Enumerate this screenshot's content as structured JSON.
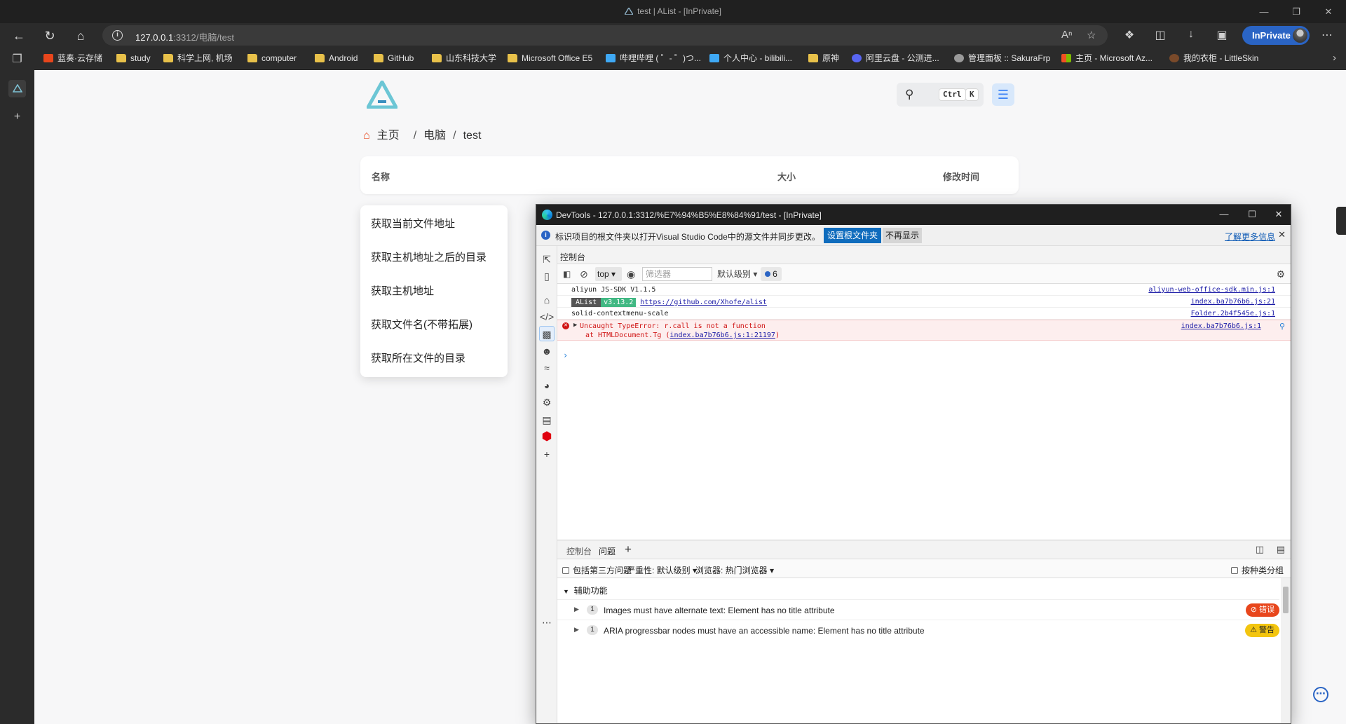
{
  "window": {
    "title": "test | AList - [InPrivate]"
  },
  "browser": {
    "url_host": "127.0.0.1",
    "url_rest": ":3312/电脑/test",
    "inprivate_label": "InPrivate",
    "icons": [
      "back-icon",
      "refresh-icon",
      "home-icon",
      "info-icon",
      "read-aloud-icon",
      "favorite-add-icon",
      "extensions-icon",
      "split-screen-icon",
      "download-icon",
      "collections-icon",
      "more-icon"
    ]
  },
  "bookmarks": [
    {
      "label": "蓝奏·云存储",
      "kind": "site",
      "color": "#e8461c"
    },
    {
      "label": "study",
      "kind": "folder"
    },
    {
      "label": "科学上网, 机场",
      "kind": "folder"
    },
    {
      "label": "computer",
      "kind": "folder"
    },
    {
      "label": "Android",
      "kind": "folder"
    },
    {
      "label": "GitHub",
      "kind": "folder"
    },
    {
      "label": "山东科技大学",
      "kind": "folder"
    },
    {
      "label": "Microsoft Office E5",
      "kind": "folder"
    },
    {
      "label": "哔哩哔哩 ( ゜- ゜)つ...",
      "kind": "site",
      "color": "#3fa9f5"
    },
    {
      "label": "个人中心 - bilibili...",
      "kind": "site",
      "color": "#3fa9f5"
    },
    {
      "label": "原神",
      "kind": "folder"
    },
    {
      "label": "阿里云盘 - 公测进...",
      "kind": "site",
      "color": "#5865f2"
    },
    {
      "label": "管理面板 :: SakuraFrp",
      "kind": "site",
      "color": "#9a9a9a"
    },
    {
      "label": "主页 - Microsoft Az...",
      "kind": "site",
      "color": "#f25022"
    },
    {
      "label": "我的衣柜 - LittleSkin",
      "kind": "site",
      "color": "#7a4a2a"
    }
  ],
  "page": {
    "search_shortcut": [
      "Ctrl",
      "K"
    ],
    "breadcrumb": [
      "主页",
      "电脑",
      "test"
    ],
    "columns": {
      "name": "名称",
      "size": "大小",
      "modified": "修改时间"
    },
    "context_menu": [
      "获取当前文件地址",
      "获取主机地址之后的目录",
      "获取主机地址",
      "获取文件名(不带拓展)",
      "获取所在文件的目录"
    ]
  },
  "devtools": {
    "title": "DevTools - 127.0.0.1:3312/%E7%94%B5%E8%84%91/test - [InPrivate]",
    "info_message": "标识项目的根文件夹以打开Visual Studio Code中的源文件并同步更改。",
    "info_set_root": "设置根文件夹",
    "info_dismiss": "不再显示",
    "info_learn_more": "了解更多信息",
    "panel_label": "控制台",
    "toolbar": {
      "context": "top",
      "filter_placeholder": "筛选器",
      "levels": "默认级别",
      "issues_count": "6"
    },
    "logs": [
      {
        "text": "aliyun JS-SDK V1.1.5",
        "source": "aliyun-web-office-sdk.min.js:1"
      },
      {
        "tag": "AList",
        "version": "v3.13.2",
        "link": "https://github.com/Xhofe/alist",
        "source": "index.ba7b76b6.js:21"
      },
      {
        "text": "solid-contextmenu-scale",
        "source": "Folder.2b4f545e.js:1"
      }
    ],
    "error": {
      "message": "Uncaught TypeError: r.call is not a function",
      "stack_prefix": "at HTMLDocument.Tg (",
      "stack_link": "index.ba7b76b6.js:1:21197",
      "stack_suffix": ")",
      "source": "index.ba7b76b6.js:1"
    },
    "prompt": "›",
    "drawer_tabs": [
      "控制台",
      "问题"
    ],
    "issues_toolbar": {
      "third_party": "包括第三方问题",
      "severity": "严重性: 默认级别",
      "browser": "浏览器: 热门浏览器",
      "group_by_kind": "按种类分组"
    },
    "issues": {
      "group": "辅助功能",
      "items": [
        {
          "count": "1",
          "text": "Images must have alternate text: Element has no title attribute",
          "severity": "错误",
          "kind": "err"
        },
        {
          "count": "1",
          "text": "ARIA progressbar nodes must have an accessible name: Element has no title attribute",
          "severity": "警告",
          "kind": "warn"
        }
      ]
    }
  }
}
